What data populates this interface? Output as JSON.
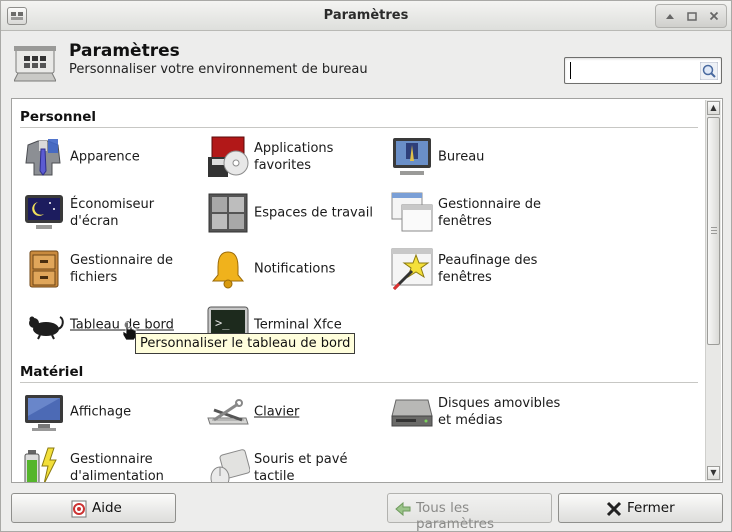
{
  "window": {
    "title": "Paramètres"
  },
  "header": {
    "title": "Paramètres",
    "subtitle": "Personnaliser votre environnement de bureau",
    "search_value": ""
  },
  "sections": [
    {
      "title": "Personnel",
      "items": [
        {
          "label": "Apparence",
          "icon": "appearance-icon"
        },
        {
          "label": "Applications\nfavorites",
          "icon": "preferred-applications-icon"
        },
        {
          "label": "Bureau",
          "icon": "desktop-icon"
        },
        {
          "label": "Économiseur\nd'écran",
          "icon": "screensaver-icon"
        },
        {
          "label": "Espaces de travail",
          "icon": "workspaces-icon"
        },
        {
          "label": "Gestionnaire de\nfenêtres",
          "icon": "window-manager-icon"
        },
        {
          "label": "Gestionnaire de\nfichiers",
          "icon": "file-manager-icon"
        },
        {
          "label": "Notifications",
          "icon": "notifications-bell-icon"
        },
        {
          "label": "Peaufinage des\nfenêtres",
          "icon": "window-tweaks-icon"
        },
        {
          "label": "Tableau de bord",
          "icon": "panel-mouse-icon"
        },
        {
          "label": "Terminal Xfce",
          "icon": "terminal-icon"
        }
      ]
    },
    {
      "title": "Matériel",
      "items": [
        {
          "label": "Affichage",
          "icon": "display-monitor-icon"
        },
        {
          "label": "Clavier",
          "icon": "keyboard-icon"
        },
        {
          "label": "Disques amovibles\net médias",
          "icon": "removable-drive-icon"
        },
        {
          "label": "Gestionnaire\nd'alimentation",
          "icon": "battery-icon"
        },
        {
          "label": "Souris et pavé\ntactile",
          "icon": "mouse-touchpad-icon"
        }
      ]
    }
  ],
  "tooltip": "Personnaliser le tableau de bord",
  "buttons": {
    "help": "Aide",
    "all_settings": "Tous les paramètres",
    "close": "Fermer"
  },
  "colors": {
    "tooltip_bg": "#fffedc",
    "accent": "#3b5ea8"
  }
}
